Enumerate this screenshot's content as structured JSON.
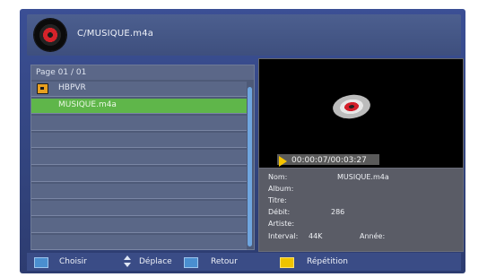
{
  "header": {
    "path": "C/MUSIQUE.m4a",
    "icon": "music-disc-icon"
  },
  "list": {
    "page_label": "Page 01 / 01",
    "items": [
      {
        "label": "HBPVR",
        "type": "folder",
        "selected": false
      },
      {
        "label": "MUSIQUE.m4a",
        "type": "file",
        "selected": true
      }
    ]
  },
  "preview": {
    "time": "00:00:07/00:03:27",
    "icon": "cd-icon",
    "play_icon": "play-icon"
  },
  "info": {
    "nom_label": "Nom:",
    "nom_value": "MUSIQUE.m4a",
    "album_label": "Album:",
    "titre_label": "Titre:",
    "debit_label": "Débit:",
    "debit_value": "286",
    "artiste_label": "Artiste:",
    "interval_label": "Interval:",
    "interval_value": "44K",
    "annee_label": "Année:"
  },
  "footer": {
    "ok_key": "OK",
    "choisir": "Choisir",
    "deplace": "Déplace",
    "menu_key": "MENU",
    "retour": "Retour",
    "repetition": "Répétition"
  },
  "colors": {
    "background": "#3b4f95",
    "selection": "#5fb64a",
    "accent_yellow": "#f0c400",
    "button_blue": "#4a8fd0"
  }
}
